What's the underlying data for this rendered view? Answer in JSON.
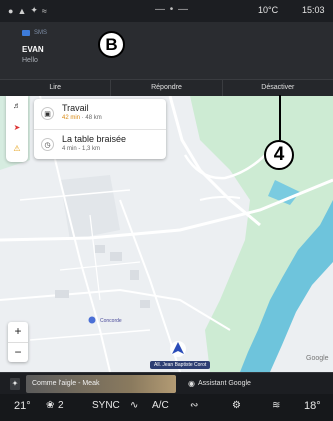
{
  "status_bar": {
    "temperature": "10°C",
    "time": "15:03"
  },
  "notification": {
    "app": "SMS",
    "sender": "EVAN",
    "message": "Hello",
    "callout_b": "B",
    "actions": [
      "Lire",
      "Répondre",
      "Désactiver"
    ]
  },
  "callout_4": "4",
  "destinations": [
    {
      "name": "Travail",
      "minutes": "42 min",
      "distance": "48 km",
      "icon": "briefcase-icon"
    },
    {
      "name": "La table braisée",
      "minutes": "4 min",
      "distance": "1,3 km",
      "icon": "clock-icon"
    }
  ],
  "map": {
    "street_label": "All. Jean Baptiste Corot",
    "poi_label": "Concorde",
    "attribution": "Google",
    "zoom_in": "+",
    "zoom_out": "−"
  },
  "media": {
    "now_playing": "Comme l'aigle - Meak",
    "assistant": "Assistant Google"
  },
  "climate": {
    "left_temp": "21°",
    "fan": "2",
    "sync": "SYNC",
    "ac": "A/C",
    "right_temp": "18°"
  },
  "colors": {
    "water": "#6ec4dc",
    "park": "#cdebd3",
    "route": "#ffffff",
    "eta_orange": "#d98a14"
  }
}
